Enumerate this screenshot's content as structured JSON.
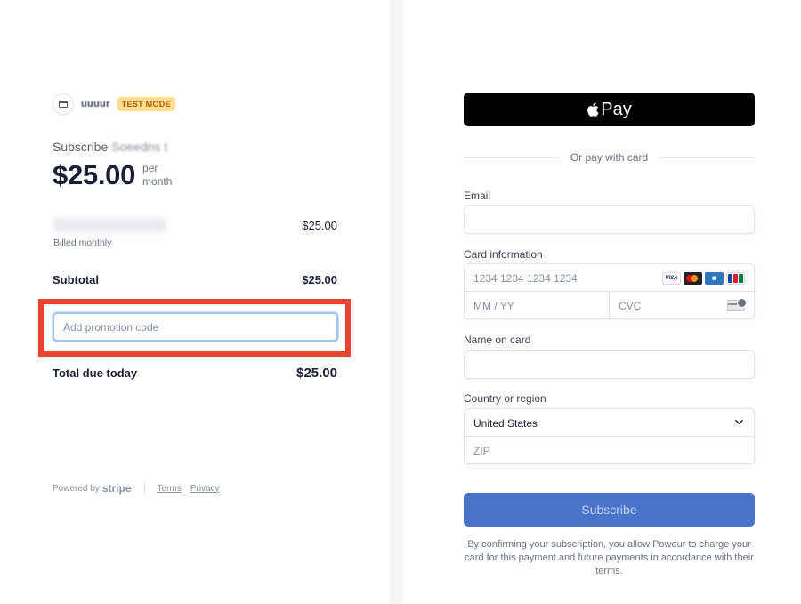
{
  "merchant": {
    "name": "uuuur",
    "badge": "TEST MODE",
    "logo_icon": "store-icon"
  },
  "summary": {
    "subscribe_prefix": "Subscribe",
    "product_name": "Soeedns t",
    "price": "$25.00",
    "per": "per",
    "period": "month",
    "line_item": {
      "name": "",
      "amount": "$25.00",
      "billing": "Billed monthly"
    },
    "subtotal": {
      "label": "Subtotal",
      "amount": "$25.00"
    },
    "promo": {
      "placeholder": "Add promotion code"
    },
    "total": {
      "label": "Total due today",
      "amount": "$25.00"
    }
  },
  "footer": {
    "powered_by": "Powered by",
    "brand": "stripe",
    "terms": "Terms",
    "privacy": "Privacy"
  },
  "payment": {
    "applepay": {
      "label": "Pay",
      "icon": "apple-icon"
    },
    "divider_text": "Or pay with card",
    "email_label": "Email",
    "card_label": "Card information",
    "card_number_placeholder": "1234 1234 1234 1234",
    "expiry_placeholder": "MM / YY",
    "cvc_placeholder": "CVC",
    "card_brands": [
      "VISA",
      "mastercard-icon",
      "amex-icon",
      "jcb-icon"
    ],
    "name_label": "Name on card",
    "country_label": "Country or region",
    "country_value": "United States",
    "zip_placeholder": "ZIP",
    "subscribe_button": "Subscribe",
    "confirm_text": "By confirming your subscription, you allow Powdur to charge your card for this payment and future payments in accordance with their terms."
  },
  "colors": {
    "highlight": "#e8442f",
    "subscribe_button": "#4a74c9",
    "test_badge_bg": "#ffde92",
    "test_badge_text": "#bb5504"
  }
}
